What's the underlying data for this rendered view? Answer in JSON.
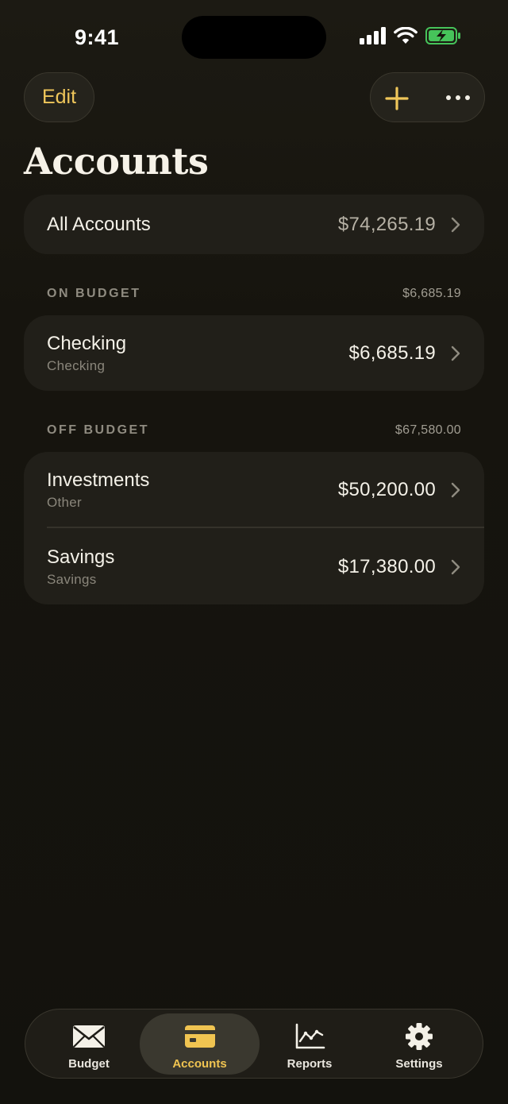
{
  "status_bar": {
    "time": "9:41",
    "battery_color": "#46c35a"
  },
  "header": {
    "edit_label": "Edit",
    "add_icon": "plus-icon",
    "more_icon": "ellipsis-icon",
    "accent": "#efc65a"
  },
  "page_title": "Accounts",
  "all_accounts": {
    "label": "All Accounts",
    "amount": "$74,265.19"
  },
  "on_budget": {
    "label": "ON BUDGET",
    "total": "$6,685.19",
    "accounts": [
      {
        "name": "Checking",
        "type": "Checking",
        "amount": "$6,685.19"
      }
    ]
  },
  "off_budget": {
    "label": "OFF BUDGET",
    "total": "$67,580.00",
    "accounts": [
      {
        "name": "Investments",
        "type": "Other",
        "amount": "$50,200.00"
      },
      {
        "name": "Savings",
        "type": "Savings",
        "amount": "$17,380.00"
      }
    ]
  },
  "tabs": [
    {
      "label": "Budget",
      "icon": "envelope-icon",
      "active": false
    },
    {
      "label": "Accounts",
      "icon": "card-icon",
      "active": true
    },
    {
      "label": "Reports",
      "icon": "chart-icon",
      "active": false
    },
    {
      "label": "Settings",
      "icon": "gear-icon",
      "active": false
    }
  ]
}
